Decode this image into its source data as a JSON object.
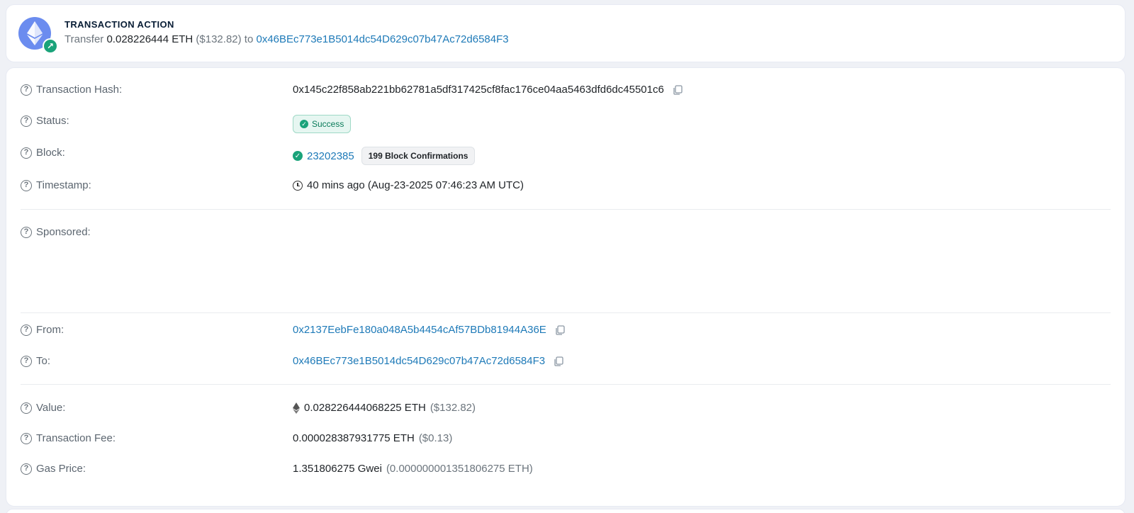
{
  "action": {
    "title": "TRANSACTION ACTION",
    "verb": "Transfer",
    "amount": "0.028226444 ETH",
    "usd": "($132.82)",
    "to_word": "to",
    "to_address": "0x46BEc773e1B5014dc54D629c07b47Ac72d6584F3"
  },
  "details": {
    "hash": {
      "label": "Transaction Hash:",
      "value": "0x145c22f858ab221bb62781a5df317425cf8fac176ce04aa5463dfd6dc45501c6"
    },
    "status": {
      "label": "Status:",
      "value": "Success"
    },
    "block": {
      "label": "Block:",
      "number": "23202385",
      "confirmations": "199 Block Confirmations"
    },
    "timestamp": {
      "label": "Timestamp:",
      "value": "40 mins ago (Aug-23-2025 07:46:23 AM UTC)"
    },
    "sponsored": {
      "label": "Sponsored:"
    },
    "from": {
      "label": "From:",
      "value": "0x2137EebFe180a048A5b4454cAf57BDb81944A36E"
    },
    "to": {
      "label": "To:",
      "value": "0x46BEc773e1B5014dc54D629c07b47Ac72d6584F3"
    },
    "value": {
      "label": "Value:",
      "amount": "0.028226444068225 ETH",
      "usd": "($132.82)"
    },
    "fee": {
      "label": "Transaction Fee:",
      "amount": "0.000028387931775 ETH",
      "usd": "($0.13)"
    },
    "gas": {
      "label": "Gas Price:",
      "amount": "1.351806275 Gwei",
      "eth": "(0.000000001351806275 ETH)"
    }
  },
  "colors": {
    "link": "#1e7ab8",
    "success": "#1aa37a",
    "eth_logo": "#6b8cef"
  }
}
